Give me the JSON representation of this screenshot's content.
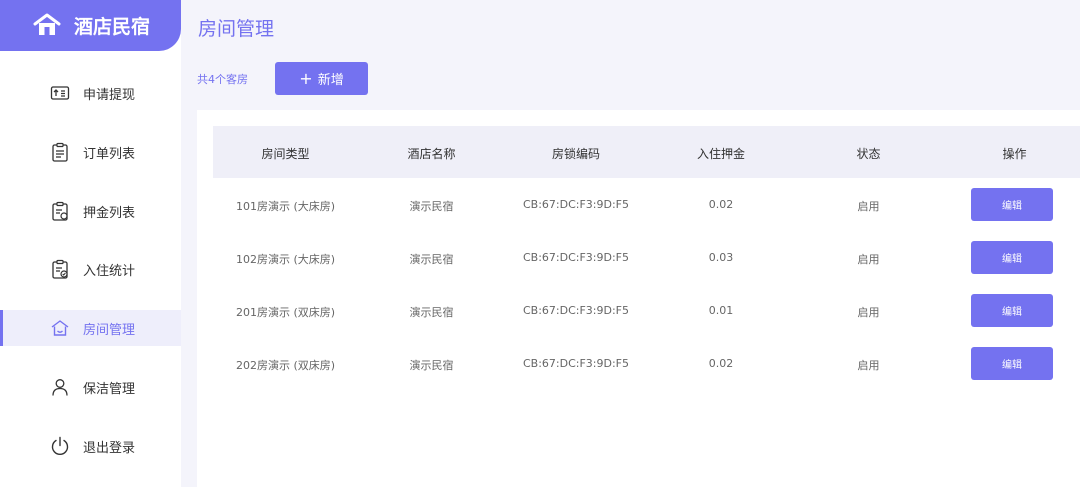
{
  "brand": {
    "title": "酒店民宿",
    "icon": "home-icon"
  },
  "sidebar": {
    "items": [
      {
        "label": "申请提现",
        "icon": "withdraw-icon"
      },
      {
        "label": "订单列表",
        "icon": "order-list-icon"
      },
      {
        "label": "押金列表",
        "icon": "deposit-list-icon"
      },
      {
        "label": "入住统计",
        "icon": "checkin-stats-icon"
      },
      {
        "label": "房间管理",
        "icon": "room-manage-icon",
        "active": true
      },
      {
        "label": "保洁管理",
        "icon": "user-icon"
      },
      {
        "label": "退出登录",
        "icon": "power-icon"
      }
    ]
  },
  "main": {
    "title": "房间管理",
    "count_text": "共4个客房",
    "add_label": "新增"
  },
  "table": {
    "headers": [
      "房间类型",
      "酒店名称",
      "房锁编码",
      "入住押金",
      "状态",
      "操作"
    ],
    "rows": [
      {
        "type": "101房演示 (大床房)",
        "hotel": "演示民宿",
        "lock": "CB:67:DC:F3:9D:F5",
        "deposit": "0.02",
        "status": "启用",
        "action": "编辑"
      },
      {
        "type": "102房演示 (大床房)",
        "hotel": "演示民宿",
        "lock": "CB:67:DC:F3:9D:F5",
        "deposit": "0.03",
        "status": "启用",
        "action": "编辑"
      },
      {
        "type": "201房演示 (双床房)",
        "hotel": "演示民宿",
        "lock": "CB:67:DC:F3:9D:F5",
        "deposit": "0.01",
        "status": "启用",
        "action": "编辑"
      },
      {
        "type": "202房演示 (双床房)",
        "hotel": "演示民宿",
        "lock": "CB:67:DC:F3:9D:F5",
        "deposit": "0.02",
        "status": "启用",
        "action": "编辑"
      }
    ]
  },
  "colors": {
    "accent": "#7472f0",
    "active_bg": "#eeeefb",
    "header_bg": "#efeff8"
  }
}
